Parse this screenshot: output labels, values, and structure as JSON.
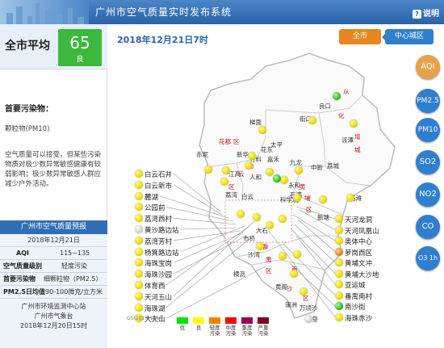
{
  "header": {
    "title": "广州市空气质量实时发布系统",
    "help_label": "说明"
  },
  "summary": {
    "avg_label": "全市平均",
    "aqi_value": "65",
    "aqi_level": "良",
    "primary_pollutant_heading": "首要污染物：",
    "primary_pollutant": "颗粒物(PM10)",
    "advice": "空气质量可以接受，但某些污染物质对极少数异常敏感健康有较弱影响；极少数异常敏感人群应减少户外活动。"
  },
  "forecast": {
    "title": "广州市空气质量预报",
    "date": "2018年12月21日",
    "aqi_key": "AQI",
    "aqi_val": "115~135",
    "level_key": "空气质量级别",
    "level_val": "轻度污染",
    "pollutant_key": "首要污染物",
    "pollutant_val": "细颗粒物（PM2.5）",
    "pm25_key": "PM2.5日均值",
    "pm25_val": "90-100微克/立方米",
    "source_1": "广州市环境监测中心站",
    "source_2": "广州市气象台",
    "issued": "2018年12月20日15时"
  },
  "main": {
    "datetime": "2018年12月21日7时",
    "btn_all": "全市",
    "btn_center": "中心城区",
    "gs_note": "GS(2017)154号"
  },
  "pollutant_buttons": [
    "AQI",
    "PM2.5",
    "PM10",
    "SO2",
    "NO2",
    "CO",
    "O3 1h"
  ],
  "active_pollutant": "AQI",
  "stations_left": [
    "白云石井",
    "白云新市",
    "麓湖",
    "公园前",
    "荔湾西村",
    "黄沙路边站",
    "荔湾芳村",
    "杨箕路边站",
    "海珠宝岗",
    "海珠沙园",
    "体育西",
    "天河五山",
    "海珠湖",
    "大夫山"
  ],
  "stations_right": [
    "天河龙洞",
    "天河凤凰山",
    "奥体中心",
    "萝岗西区",
    "黄埔文冲",
    "黄埔大沙地",
    "亚运城",
    "番禺南村",
    "南沙街",
    "海珠赤沙"
  ],
  "station_colors_right": [
    "yellow",
    "yellow",
    "yellow",
    "orange",
    "yellow",
    "yellow",
    "yellow",
    "yellow",
    "green",
    "yellow"
  ],
  "districts": [
    "从",
    "化",
    "良口",
    "增",
    "城",
    "派潭",
    "街口",
    "梯面",
    "太平",
    "花都",
    "区",
    "赤坭",
    "新华",
    "竹料",
    "花东",
    "嘉禾",
    "九龙",
    "中新",
    "荔城",
    "石滩",
    "白",
    "云",
    "区",
    "江高",
    "人和",
    "科学城",
    "永和",
    "石满",
    "白云",
    "黄",
    "埔",
    "区",
    "新塘",
    "荔湾",
    "大石",
    "市桥",
    "番",
    "禺",
    "区",
    "沙湾",
    "横沥",
    "黄阁",
    "南",
    "沙",
    "区",
    "万顷沙",
    "新垦",
    "蒲洲"
  ],
  "legend": {
    "colors": [
      "#00e400",
      "#ffff00",
      "#ff7e00",
      "#ff0000",
      "#99004c",
      "#7e0023"
    ],
    "labels": [
      "优",
      "良",
      "轻度污染",
      "中度污染",
      "重度污染",
      "严重污染"
    ]
  }
}
